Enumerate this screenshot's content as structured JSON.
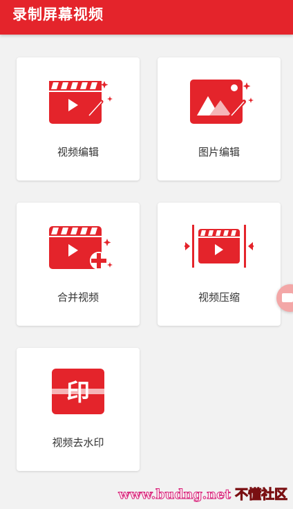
{
  "appbar": {
    "title": "录制屏幕视频"
  },
  "cards": [
    {
      "label": "视频编辑",
      "icon": "video-edit-icon"
    },
    {
      "label": "图片编辑",
      "icon": "image-edit-icon"
    },
    {
      "label": "合并视频",
      "icon": "video-merge-icon"
    },
    {
      "label": "视频压缩",
      "icon": "video-compress-icon"
    },
    {
      "label": "视频去水印",
      "icon": "watermark-remove-icon",
      "icon_text": "印"
    }
  ],
  "watermark": {
    "url": "www.budng.net",
    "brand": "不懂社区"
  },
  "colors": {
    "accent": "#e4242b",
    "background": "#f2f2f2",
    "card": "#ffffff",
    "text": "#333333"
  }
}
